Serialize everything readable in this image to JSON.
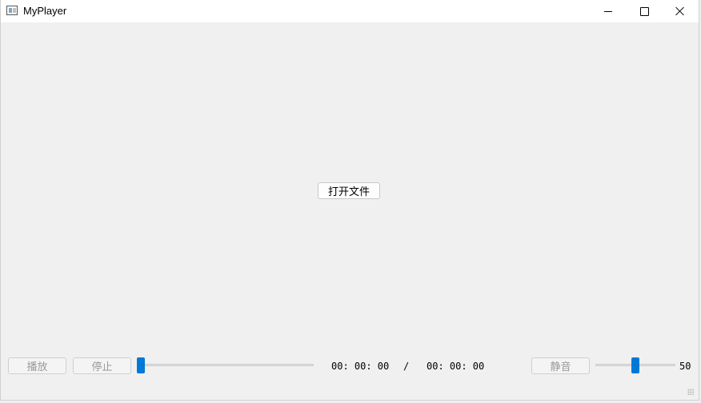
{
  "window": {
    "title": "MyPlayer",
    "controls": {
      "minimize": "minimize-icon",
      "maximize": "maximize-icon",
      "close": "close-icon"
    }
  },
  "main": {
    "open_file_label": "打开文件"
  },
  "controls": {
    "play_label": "播放",
    "stop_label": "停止",
    "mute_label": "静音",
    "progress_fraction": 0,
    "current_time": "00: 00: 00",
    "separator": "/",
    "total_time": "00: 00: 00",
    "volume": 50,
    "volume_value": "50"
  },
  "colors": {
    "accent": "#0078d7",
    "background": "#f0f0f0",
    "titlebar": "#ffffff",
    "disabled_text": "#9a9a9a"
  }
}
